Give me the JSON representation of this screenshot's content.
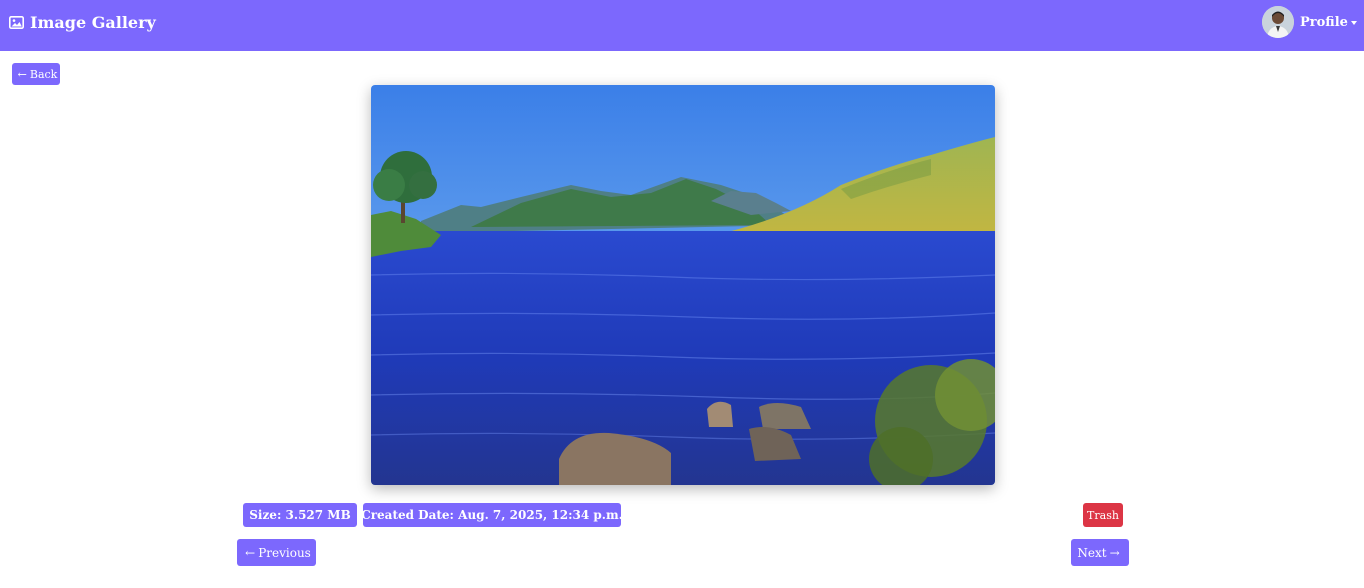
{
  "navbar": {
    "brand_title": "Image Gallery",
    "brand_icon": "image-icon",
    "profile_label": "Profile",
    "profile_caret_icon": "caret-down-icon",
    "accent_color": "#7c68fd"
  },
  "back_button": {
    "arrow": "←",
    "label": "Back"
  },
  "photo": {
    "subject": "Lake with hills under blue sky"
  },
  "info": {
    "size": "Size: 3.527 MB",
    "created": "Created Date: Aug. 7, 2025, 12:34 p.m."
  },
  "actions": {
    "trash_label": "Trash",
    "trash_color": "#dc3545",
    "previous_arrow": "←",
    "previous_label": "Previous",
    "next_label": "Next",
    "next_arrow": "→"
  }
}
